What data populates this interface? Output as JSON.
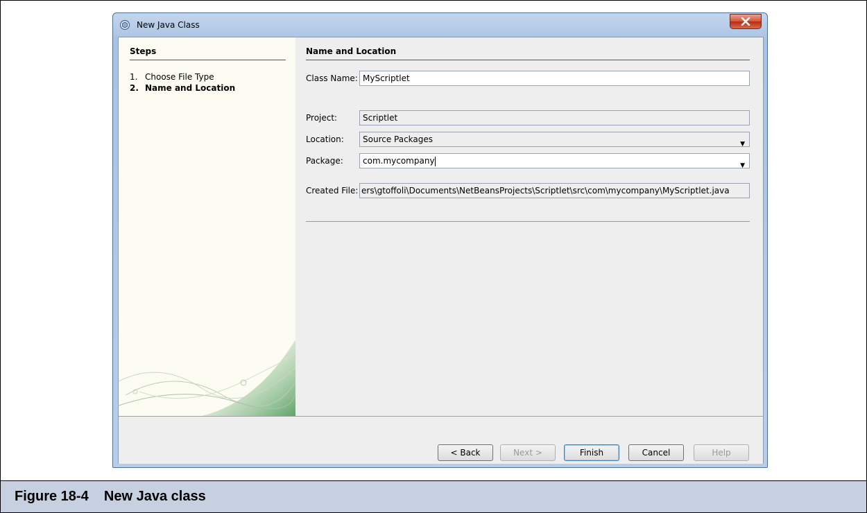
{
  "window": {
    "title": "New Java Class",
    "close_label": "X"
  },
  "steps": {
    "heading": "Steps",
    "items": [
      {
        "num": "1.",
        "label": "Choose File Type"
      },
      {
        "num": "2.",
        "label": "Name and Location"
      }
    ]
  },
  "panel": {
    "heading": "Name and Location",
    "class_name_label": "Class Name:",
    "class_name_value": "MyScriptlet",
    "project_label": "Project:",
    "project_value": "Scriptlet",
    "location_label": "Location:",
    "location_value": "Source Packages",
    "package_label": "Package:",
    "package_value": "com.mycompany",
    "created_file_label": "Created File:",
    "created_file_value": "ers\\gtoffoli\\Documents\\NetBeansProjects\\Scriptlet\\src\\com\\mycompany\\MyScriptlet.java"
  },
  "buttons": {
    "back": "< Back",
    "next": "Next >",
    "finish": "Finish",
    "cancel": "Cancel",
    "help": "Help"
  },
  "caption": {
    "text": "Figure 18-4    New Java class"
  }
}
